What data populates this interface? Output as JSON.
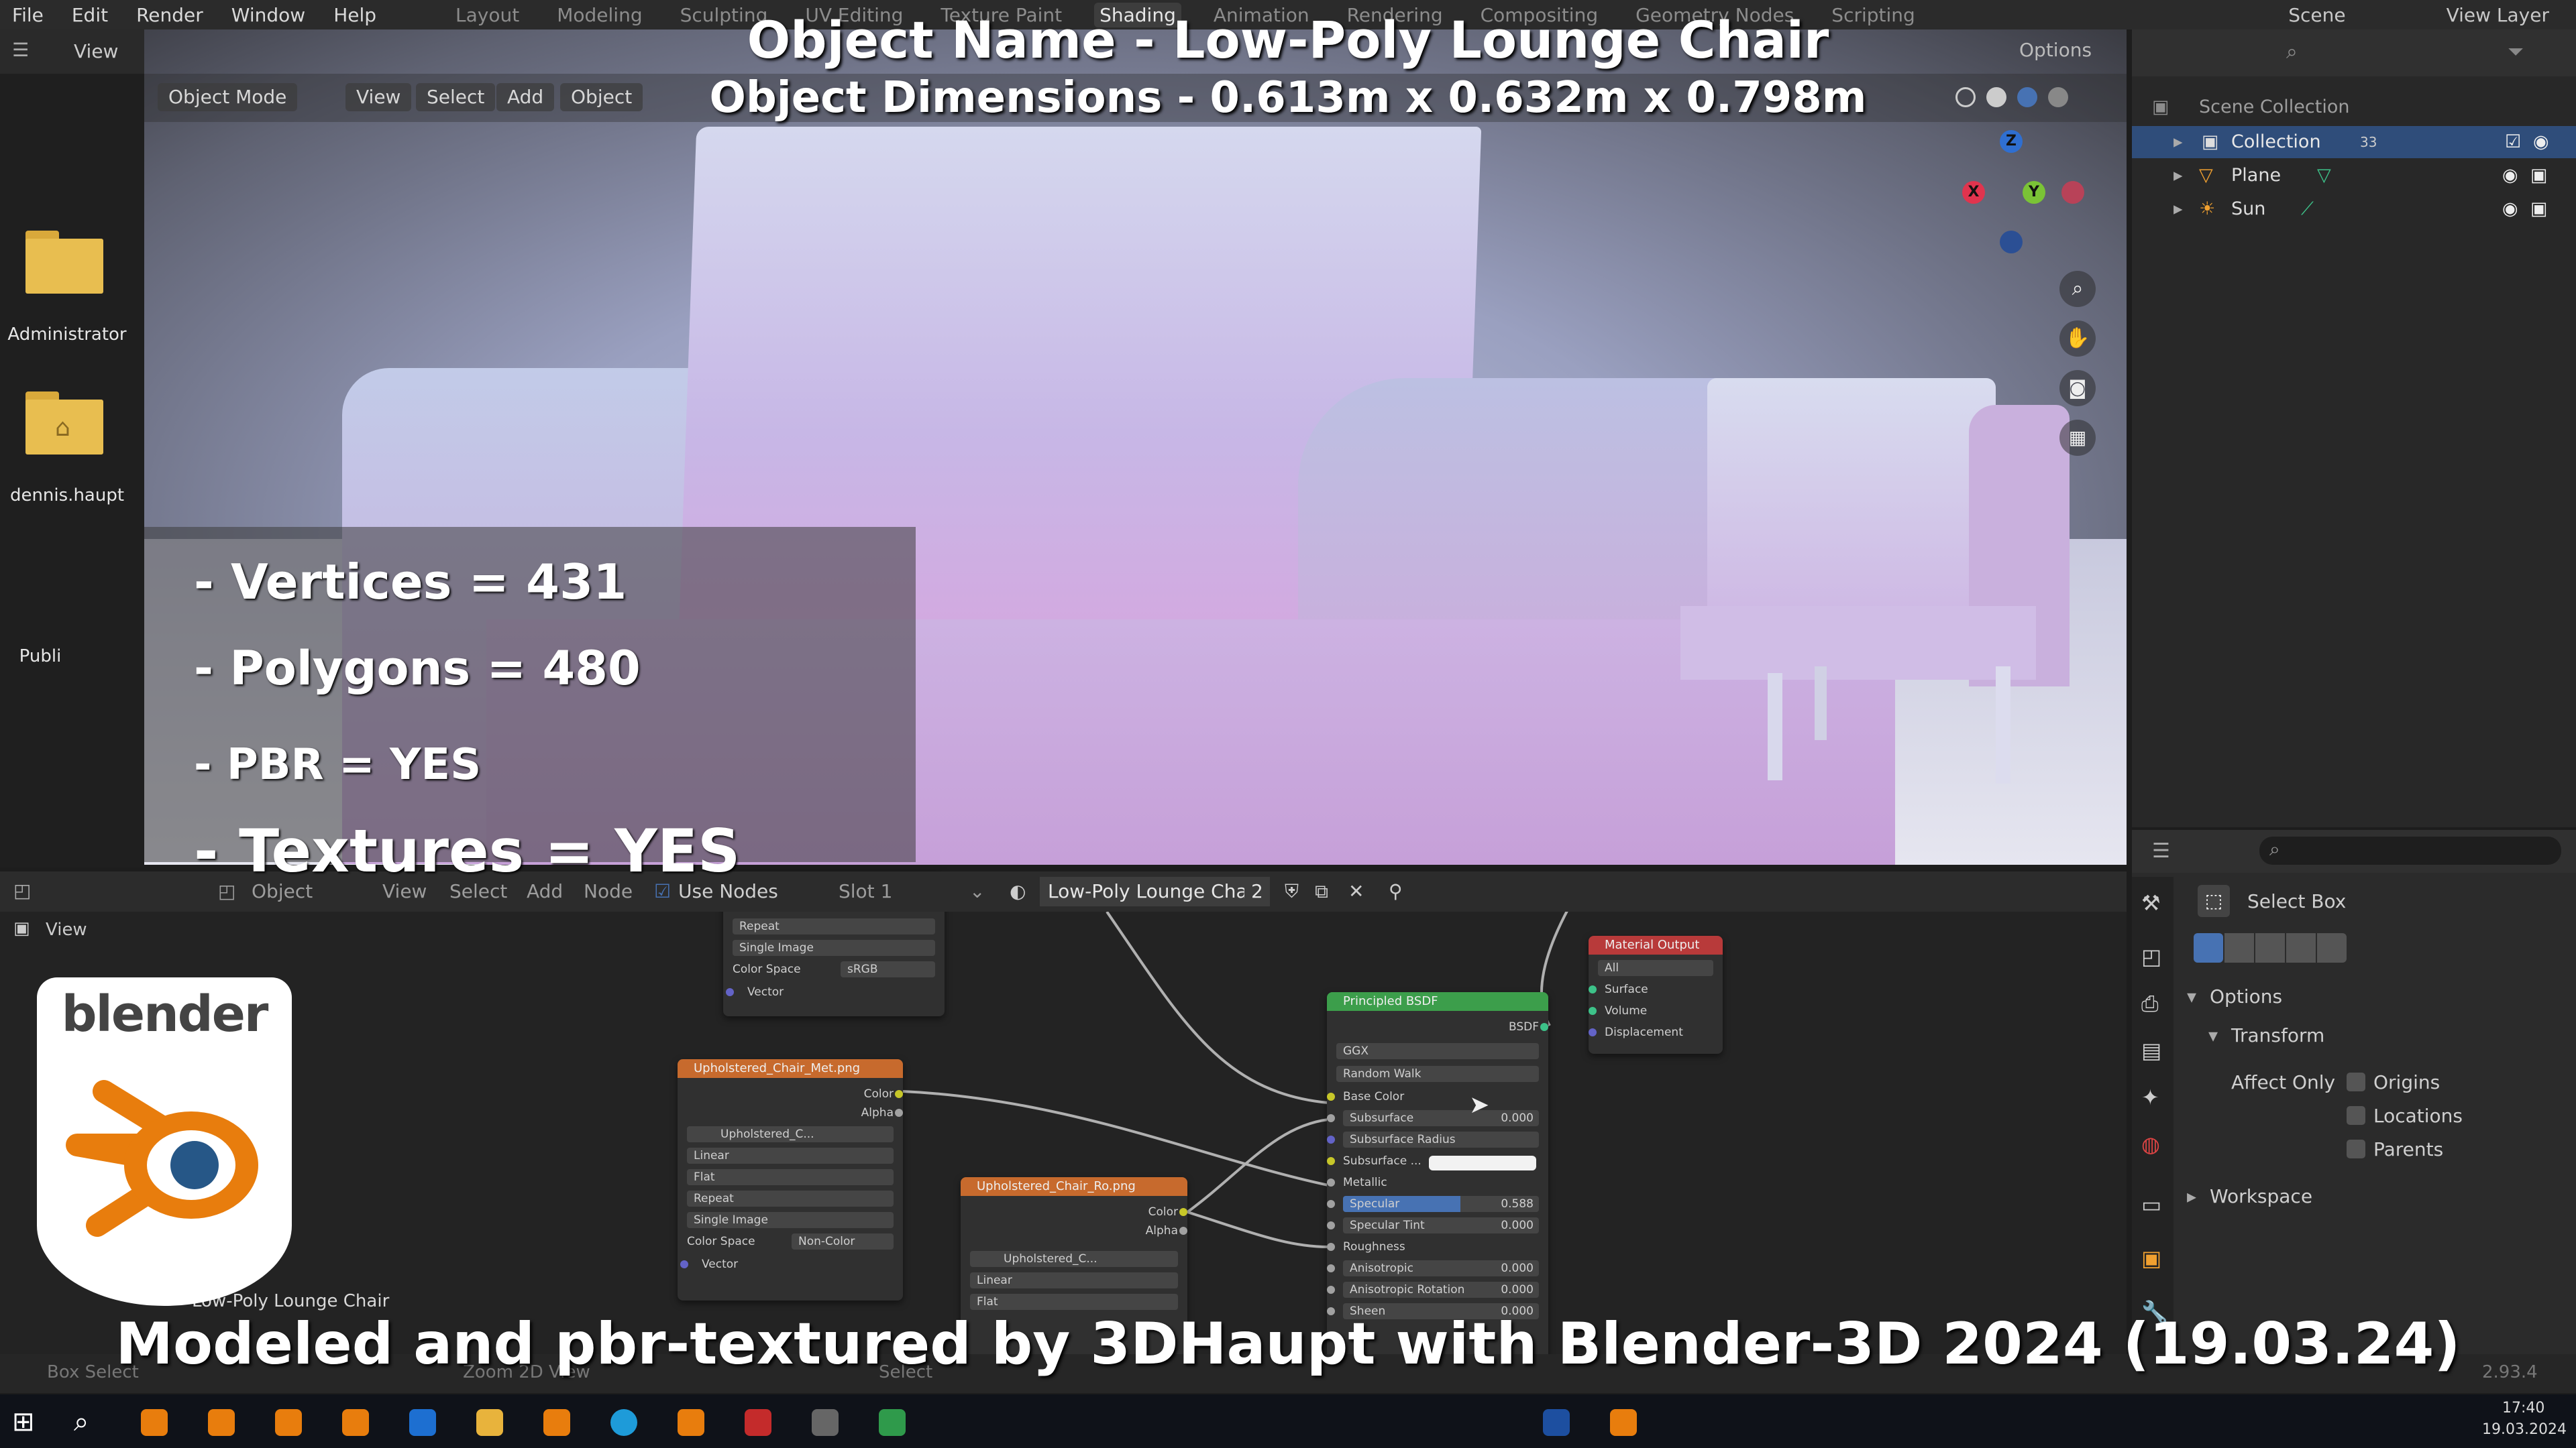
{
  "menubar": {
    "menus": [
      "File",
      "Edit",
      "Render",
      "Window",
      "Help"
    ],
    "workspaces": [
      "Layout",
      "Modeling",
      "Sculpting",
      "UV Editing",
      "Texture Paint",
      "Shading",
      "Animation",
      "Rendering",
      "Compositing",
      "Geometry Nodes",
      "Scripting"
    ],
    "active_workspace": "Shading",
    "scene": "Scene",
    "view_layer": "View Layer"
  },
  "desktop": {
    "icons": [
      "Administrator",
      "dennis.haupt",
      "Publi"
    ]
  },
  "viewport": {
    "header": {
      "mode": "Object Mode",
      "view": "View",
      "select": "Select",
      "add": "Add",
      "object": "Object",
      "options": "Options"
    },
    "left_view": "View",
    "gizmo": {
      "x": "X",
      "y": "Y",
      "z": "Z"
    }
  },
  "overlay": {
    "title": "Object Name - Low-Poly Lounge Chair",
    "dimensions": "Object Dimensions -  0.613m x 0.632m x 0.798m",
    "stats": {
      "vertices": "- Vertices = 431",
      "polygons": "- Polygons = 480",
      "pbr": "- PBR =  YES",
      "textures": "- Textures = YES"
    },
    "caption": "Modeled and pbr-textured by 3DHaupt with Blender-3D 2024 (19.03.24)",
    "logo_text": "blender"
  },
  "outliner": {
    "title": "Scene Collection",
    "items": [
      {
        "label": "Collection",
        "badge": "33"
      },
      {
        "label": "Plane"
      },
      {
        "label": "Sun"
      }
    ]
  },
  "properties": {
    "tool": "Select Box",
    "options": "Options",
    "transform": "Transform",
    "affect_only": "Affect Only",
    "checks": [
      "Origins",
      "Locations",
      "Parents"
    ],
    "workspace": "Workspace"
  },
  "node_editor": {
    "header": {
      "editor": "Object",
      "view": "View",
      "select": "Select",
      "add": "Add",
      "node": "Node",
      "use_nodes": "Use Nodes",
      "slot": "Slot 1",
      "material": "Low-Poly Lounge Chair",
      "users": "2"
    },
    "side_view": "View",
    "frame_label": "Low-Poly Lounge Chair",
    "node_tex1_top": {
      "rows": [
        "Repeat",
        "Single Image",
        "Color Space",
        "sRGB",
        "Vector"
      ]
    },
    "node_met": {
      "title": "Upholstered_Chair_Met.png",
      "outputs": [
        "Color",
        "Alpha"
      ],
      "image": "Upholstered_C...",
      "rows": [
        "Linear",
        "Flat",
        "Repeat",
        "Single Image"
      ],
      "color_space_label": "Color Space",
      "color_space": "Non-Color",
      "vector": "Vector"
    },
    "node_ro": {
      "title": "Upholstered_Chair_Ro.png",
      "outputs": [
        "Color",
        "Alpha"
      ],
      "image": "Upholstered_C...",
      "rows": [
        "Linear",
        "Flat"
      ]
    },
    "node_bsdf": {
      "title": "Principled BSDF",
      "output": "BSDF",
      "dist": "GGX",
      "sss": "Random Walk",
      "inputs": [
        {
          "label": "Base Color"
        },
        {
          "label": "Subsurface",
          "value": "0.000"
        },
        {
          "label": "Subsurface Radius"
        },
        {
          "label": "Subsurface ..."
        },
        {
          "label": "Metallic"
        },
        {
          "label": "Specular",
          "value": "0.588"
        },
        {
          "label": "Specular Tint",
          "value": "0.000"
        },
        {
          "label": "Roughness"
        },
        {
          "label": "Anisotropic",
          "value": "0.000"
        },
        {
          "label": "Anisotropic Rotation",
          "value": "0.000"
        },
        {
          "label": "Sheen",
          "value": "0.000"
        }
      ]
    },
    "node_out": {
      "title": "Material Output",
      "target": "All",
      "inputs": [
        "Surface",
        "Volume",
        "Displacement"
      ]
    }
  },
  "statusbar": {
    "left": "Box Select",
    "mid": "Zoom 2D View",
    "mid2": "Select",
    "version": "2.93.4"
  },
  "taskbar": {
    "time": "17:40",
    "date": "19.03.2024"
  },
  "colors": {
    "accent_blue": "#4772b3",
    "texture_node": "#c76a2d",
    "shader_node": "#3c9e4b",
    "output_node": "#b83a3a",
    "blender_orange": "#e87d0d",
    "blender_blue": "#265787"
  }
}
